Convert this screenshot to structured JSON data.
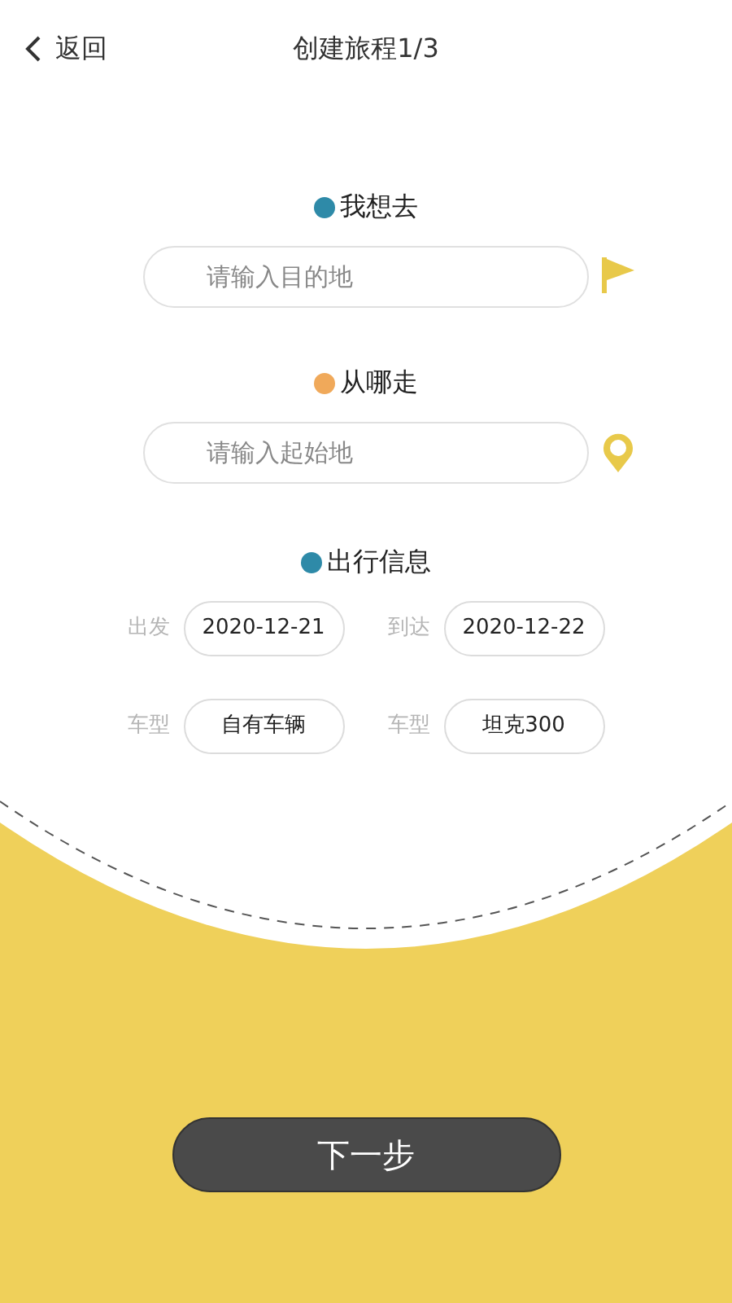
{
  "header": {
    "back": "返回",
    "title": "创建旅程1/3"
  },
  "destination": {
    "label": "我想去",
    "color": "#2e8aa8",
    "placeholder": "请输入目的地"
  },
  "origin": {
    "label": "从哪走",
    "color": "#f0a95a",
    "placeholder": "请输入起始地"
  },
  "trip_info": {
    "label": "出行信息",
    "color": "#2e8aa8",
    "fields": [
      {
        "label": "出发",
        "value": "2020-12-21"
      },
      {
        "label": "到达",
        "value": "2020-12-22"
      },
      {
        "label": "车型",
        "value": "自有车辆"
      },
      {
        "label": "车型",
        "value": "坦克300"
      }
    ]
  },
  "next_button": "下一步"
}
